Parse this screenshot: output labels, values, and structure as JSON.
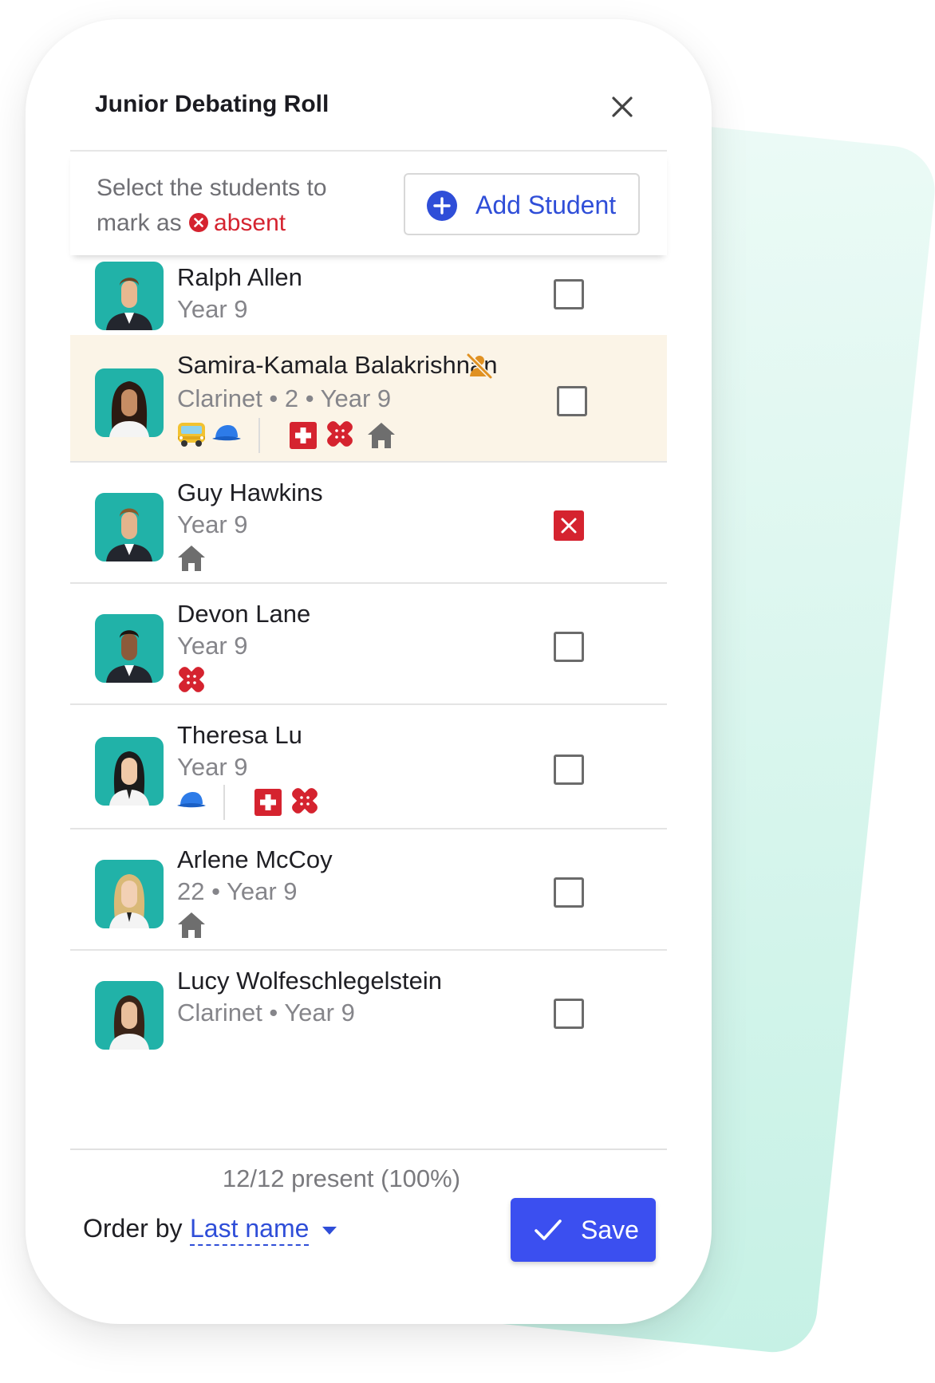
{
  "modal": {
    "title": "Junior Debating Roll",
    "close_icon": "close-icon"
  },
  "instruction": {
    "text": "Select the students to mark as",
    "absent_label": "absent",
    "absent_color": "#d5232f"
  },
  "add_student": {
    "label": "Add Student",
    "icon": "plus-circle-icon"
  },
  "students": [
    {
      "name": "Ralph Allen",
      "detail": "Year 9",
      "selected": false,
      "icons_left": [],
      "icons_right": []
    },
    {
      "name": "Samira-Kamala Balakrishnan",
      "detail": "Clarinet • 2 • Year 9",
      "selected": false,
      "highlighted": true,
      "name_icon": "no-photo-icon",
      "icons_left": [
        "bus-icon",
        "cap-icon"
      ],
      "icons_right": [
        "medical-cross-icon",
        "bandage-icon",
        "home-icon"
      ]
    },
    {
      "name": "Guy Hawkins",
      "detail": "Year 9",
      "selected": true,
      "icons_left": [
        "home-icon"
      ],
      "icons_right": []
    },
    {
      "name": "Devon Lane",
      "detail": "Year 9",
      "selected": false,
      "icons_left": [
        "bandage-icon"
      ],
      "icons_right": []
    },
    {
      "name": "Theresa Lu",
      "detail": "Year 9",
      "selected": false,
      "icons_left": [
        "cap-icon"
      ],
      "icons_right": [
        "medical-cross-icon",
        "bandage-icon"
      ]
    },
    {
      "name": "Arlene McCoy",
      "detail": "22 • Year 9",
      "selected": false,
      "icons_left": [
        "home-icon"
      ],
      "icons_right": []
    },
    {
      "name": "Lucy Wolfeschlegelstein",
      "detail": "Clarinet • Year 9",
      "selected": false,
      "icons_left": [],
      "icons_right": []
    }
  ],
  "footer": {
    "summary": "12/12 present (100%)",
    "order_label": "Order by",
    "order_value": "Last name",
    "save_label": "Save"
  },
  "colors": {
    "accent": "#3b4ff0",
    "link": "#2f4ed8",
    "absent_red": "#d5232f",
    "avatar_bg": "#21b2a8",
    "highlight_row": "#fbf4e7"
  }
}
